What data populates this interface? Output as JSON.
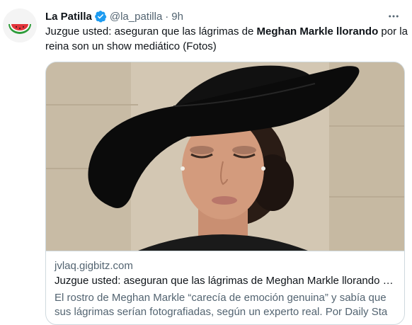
{
  "author": {
    "name": "La Patilla",
    "handle": "@la_patilla",
    "separator": "·",
    "time": "9h"
  },
  "tweet": {
    "text_part1": "Juzgue usted: aseguran que las lágrimas de ",
    "text_bold": "Meghan Markle llorando",
    "text_part2": " por la reina son un show mediático (Fotos)"
  },
  "card": {
    "domain": "jvlaq.gigbitz.com",
    "title": "Juzgue usted: aseguran que las lágrimas de Meghan Markle llorando p...",
    "description": "El rostro de Meghan Markle “carecía de emoción genuina” y sabía que sus lágrimas serían fotografiadas, según un experto real. Por Daily Sta"
  },
  "icons": {
    "avatar": "watermelon-logo-icon",
    "verified": "verified-badge-icon",
    "more": "more-options-icon"
  },
  "colors": {
    "verified_blue": "#1d9bf0",
    "secondary_text": "#536471",
    "primary_text": "#0f1419",
    "border": "#cfd9de"
  }
}
